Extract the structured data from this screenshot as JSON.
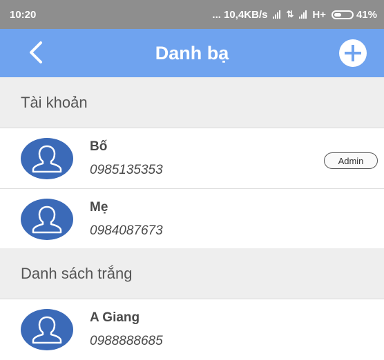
{
  "status_bar": {
    "time": "10:20",
    "network": "... 10,4KB/s",
    "network_type": "H+",
    "battery": "41%"
  },
  "header": {
    "title": "Danh bạ",
    "back_icon": "back-arrow-icon",
    "add_icon": "plus-circle-icon",
    "color": "#6fa3ef"
  },
  "sections": [
    {
      "title": "Tài khoản",
      "contacts": [
        {
          "name": "Bố",
          "phone": "0985135353",
          "badge": "Admin"
        },
        {
          "name": "Mẹ",
          "phone": "0984087673"
        }
      ]
    },
    {
      "title": "Danh sách trắng",
      "contacts": [
        {
          "name": "A Giang",
          "phone": "0988888685"
        }
      ]
    }
  ],
  "avatar_color": "#3b6ab8"
}
